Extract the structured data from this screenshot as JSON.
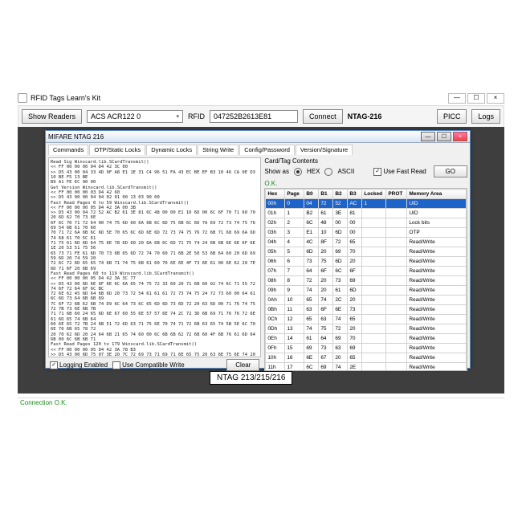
{
  "outer": {
    "title": "RFID Tags Learn's Kit",
    "show_readers": "Show Readers",
    "reader_name": "ACS ACR122 0",
    "rfid_label": "RFID",
    "rfid_value": "047252B2613E81",
    "connect": "Connect",
    "tag_name": "NTAG-216",
    "picc": "PICC",
    "logs": "Logs"
  },
  "inner": {
    "title": "MIFARE NTAG 216",
    "tabs": [
      "Commands",
      "OTP/Static Locks",
      "Dynamic Locks",
      "String Write",
      "Config/Password",
      "Version/Signature"
    ],
    "logging_enabled": "Logging Enabled",
    "compat_write": "Use Compatible Write",
    "clear": "Clear",
    "contents_title": "Card/Tag Contents",
    "show_as": "Show as",
    "hex": "HEX",
    "ascii": "ASCII",
    "use_fast_read": "Use Fast Read",
    "go": "GO",
    "ok": "O.K."
  },
  "log_lines": "Read Sig Winscard.lib.SCardTransmit()\n<< FF 00 00 00 04 D4 42 3C 00\n>> D5 43 00 04 33 4D 9F A8 E1 1E 31 C4 96 51 FA 43 EC BE EF B3 10 46 CA 0E D3 10 BE F5 13 BE\nB9 A1 FE EC 90 00\nGet Version Winscard.lib.SCardTransmit()\n<< FF 00 00 00 03 D4 42 60\n>> D5 43 00 00 04 04 02 01 00 13 03 90 00\nFast Read Pages 0 to 59 Winscard.lib.SCardTransmit()\n<< FF 00 00 00 05 D4 42 3A 00 3B\n>> D5 43 00 04 72 52 AC B2 61 3E 81 6C 48 00 00 E1 10 6D 00 6C 6F 70 71 60 70 20 6D 62 70 73 6E\n6F 6C 70 71 72 64 00 74 75 6D 60 6A 6B 6C 6D 75 6B 6C 6D 7A 69 72 73 74 75 76 69 54 6B 61 70 60\n70 71 72 6A 6B 6C 6D 5E 70 65 6C 6D 6E 6D 72 73 74 75 76 72 6B 71 68 69 6A 6D 74 68 61 70 5C 61\n71 75 61 6D 6D 64 75 6E 78 6D 60 20 6A 6B 6C 6D 71 75 74 24 6B 6B 6E 6E 6F 6E 1E 20 53 51 75 56\n65 73 71 FE 61 6D 70 73 6B 65 6D 72 74 70 60 71 6B 2E 50 53 6B 64 60 20 6D 69 59 6D 20 74 59 20\n72 6C 72 6D 65 65 74 6B 71 74 75 6B 61 60 70 6E 6E 4F 73 6E 61 00 6E 62 20 7E 6D 71 6F 20 6B 69\nFast Read Pages 60 to 119 Winscard.lib.SCardTransmit()\n<< FF 00 00 00 05 D4 42 3A 3C 77\n>> D5 43 00 6D 6E 6F 6E 6C 6A 65 74 75 72 33 60 20 71 6B 60 02 74 6C 71 55 72 74 6F 72 64 6F 6C BC\n72 6E 62 45 6D 64 6B 6D 20 73 72 54 61 61 61 72 73 74 75 24 72 73 60 00 64 61 6C 6D 73 64 6B 6B 69\n7C 6F 72 6B 62 6B 74 D9 6C 64 73 6C 65 6D 6D 73 6D 72 20 63 6D 00 71 76 74 75 72 7B 73 6E 6B 7B\n71 71 6B 60 24 65 6D 6E 67 60 55 6E 57 57 6E 74 2C 72 3D 6B 69 71 76 76 72 6E 61 6D 65 74 6B 64\n60 6E 65 72 7B 24 6B 51 72 6D 63 71 75 6E 70 74 71 72 6B 63 65 74 5B 5E 6C 70 6E 70 6B 65 78 72\n20 70 62 6D 20 24 64 6B 21 65 74 60 00 6C 6B 6B 62 72 6B 60 4F 6B 76 61 6D 64 6B 00 6C 6B 6B 71\nFast Read Pages 120 to 179 Winscard.lib.SCardTransmit()\n<< FF 00 00 00 05 D4 42 3A 78 B3\n>> D5 43 00 6D 75 07 3E 20 7C 72 69 73 71 69 71 6E 65 75 20 63 6E 75 6E 74 20 63 6D 67 6E 74 20 68 6F\n70 74 69 71 73 20 6E 69 73 74 20 6C 61 75 64 61 74 20 63 6E 74 75 6E 20 77 01 6C 75 67 74 61 74 6D 65\n63 6D 7B 73 71 20 75 61 24 20 61 68 20 74 6E 20 71 20 71 75 61 6E 20 73 6E 64 6B 61 75 64 71 20 74\n63 62 6C 55 20 64 6B 20 65 6C 6E 65 21 20 64 74 4D 65 64 74 6C 65 72 6D 6B 6D 63 68 68 68 00 6F 60",
  "columns": [
    "Hex",
    "Page",
    "B0",
    "B1",
    "B2",
    "B3",
    "Locked",
    "PROT",
    "Memory Area"
  ],
  "col_widths": [
    "24px",
    "24px",
    "18px",
    "18px",
    "18px",
    "18px",
    "30px",
    "26px",
    "auto"
  ],
  "rows": [
    {
      "hex": "00h",
      "page": "0",
      "b": [
        "04",
        "72",
        "52",
        "AC"
      ],
      "locked": "1",
      "prot": "",
      "area": "UID",
      "sel": true
    },
    {
      "hex": "01h",
      "page": "1",
      "b": [
        "B2",
        "61",
        "3E",
        "81"
      ],
      "locked": "",
      "prot": "",
      "area": "UID"
    },
    {
      "hex": "02h",
      "page": "2",
      "b": [
        "6C",
        "48",
        "00",
        "00"
      ],
      "locked": "",
      "prot": "",
      "area": "Lock bits"
    },
    {
      "hex": "03h",
      "page": "3",
      "b": [
        "E1",
        "10",
        "6D",
        "00"
      ],
      "locked": "",
      "prot": "",
      "area": "OTP"
    },
    {
      "hex": "04h",
      "page": "4",
      "b": [
        "4C",
        "8F",
        "72",
        "65"
      ],
      "locked": "",
      "prot": "",
      "area": "Read/Write"
    },
    {
      "hex": "05h",
      "page": "5",
      "b": [
        "6D",
        "20",
        "69",
        "70"
      ],
      "locked": "",
      "prot": "",
      "area": "Read/Write"
    },
    {
      "hex": "06h",
      "page": "6",
      "b": [
        "73",
        "75",
        "6D",
        "20"
      ],
      "locked": "",
      "prot": "",
      "area": "Read/Write"
    },
    {
      "hex": "07h",
      "page": "7",
      "b": [
        "64",
        "6F",
        "6C",
        "6F"
      ],
      "locked": "",
      "prot": "",
      "area": "Read/Write"
    },
    {
      "hex": "08h",
      "page": "8",
      "b": [
        "72",
        "20",
        "73",
        "69"
      ],
      "locked": "",
      "prot": "",
      "area": "Read/Write"
    },
    {
      "hex": "09h",
      "page": "9",
      "b": [
        "74",
        "20",
        "61",
        "6D"
      ],
      "locked": "",
      "prot": "",
      "area": "Read/Write"
    },
    {
      "hex": "0Ah",
      "page": "10",
      "b": [
        "65",
        "74",
        "2C",
        "20"
      ],
      "locked": "",
      "prot": "",
      "area": "Read/Write"
    },
    {
      "hex": "0Bh",
      "page": "11",
      "b": [
        "63",
        "6F",
        "6E",
        "73"
      ],
      "locked": "",
      "prot": "",
      "area": "Read/Write"
    },
    {
      "hex": "0Ch",
      "page": "12",
      "b": [
        "65",
        "63",
        "74",
        "65"
      ],
      "locked": "",
      "prot": "",
      "area": "Read/Write"
    },
    {
      "hex": "0Dh",
      "page": "13",
      "b": [
        "74",
        "75",
        "72",
        "20"
      ],
      "locked": "",
      "prot": "",
      "area": "Read/Write"
    },
    {
      "hex": "0Eh",
      "page": "14",
      "b": [
        "61",
        "64",
        "69",
        "70"
      ],
      "locked": "",
      "prot": "",
      "area": "Read/Write"
    },
    {
      "hex": "0Fh",
      "page": "15",
      "b": [
        "69",
        "73",
        "63",
        "69"
      ],
      "locked": "",
      "prot": "",
      "area": "Read/Write"
    },
    {
      "hex": "10h",
      "page": "16",
      "b": [
        "6E",
        "67",
        "20",
        "65"
      ],
      "locked": "",
      "prot": "",
      "area": "Read/Write"
    },
    {
      "hex": "11h",
      "page": "17",
      "b": [
        "6C",
        "69",
        "74",
        "2E"
      ],
      "locked": "",
      "prot": "",
      "area": "Read/Write"
    }
  ],
  "caption": "NTAG 213/215/216",
  "status": "Connection O.K."
}
